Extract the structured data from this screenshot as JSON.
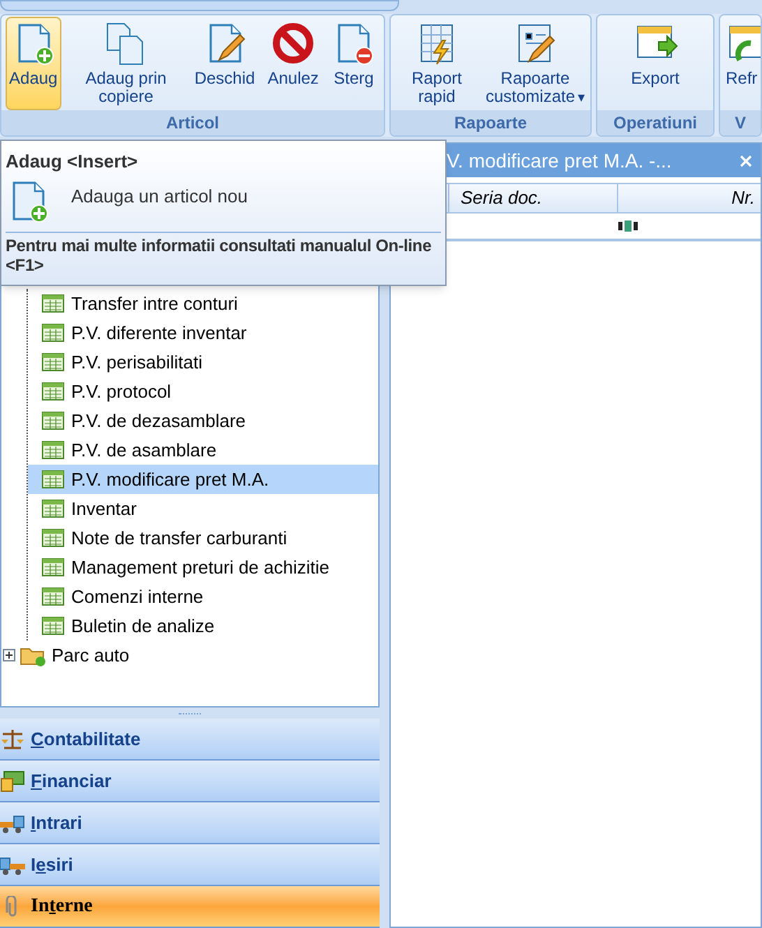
{
  "ribbon": {
    "groups": [
      {
        "label": "Articol",
        "buttons": [
          {
            "label": "Adaug",
            "highlighted": true
          },
          {
            "label": "Adaug prin copiere",
            "highlighted": false
          },
          {
            "label": "Deschid",
            "highlighted": false
          },
          {
            "label": "Anulez",
            "highlighted": false
          },
          {
            "label": "Sterg",
            "highlighted": false
          }
        ]
      },
      {
        "label": "Rapoarte",
        "buttons": [
          {
            "label": "Raport rapid",
            "highlighted": false
          },
          {
            "label": "Rapoarte customizate",
            "caret": "▾",
            "highlighted": false
          }
        ]
      },
      {
        "label": "Operatiuni",
        "buttons": [
          {
            "label": "Export",
            "highlighted": false
          }
        ]
      },
      {
        "label": "V",
        "buttons": [
          {
            "label": "Refr",
            "highlighted": false
          }
        ]
      }
    ]
  },
  "tooltip": {
    "title": "Adaug <Insert>",
    "description": "Adauga un articol nou",
    "help": "Pentru mai multe informatii consultati manualul On-line <F1>"
  },
  "tree": [
    {
      "kind": "group",
      "children": [
        {
          "label": "Transfer intre conturi",
          "selected": false
        },
        {
          "label": "P.V. diferente inventar",
          "selected": false
        },
        {
          "label": "P.V. perisabilitati",
          "selected": false
        },
        {
          "label": "P.V. protocol",
          "selected": false
        },
        {
          "label": "P.V. de dezasamblare",
          "selected": false
        },
        {
          "label": "P.V. de asamblare",
          "selected": false
        },
        {
          "label": "P.V. modificare pret M.A.",
          "selected": true
        },
        {
          "label": "Inventar",
          "selected": false
        },
        {
          "label": "Note de transfer carburanti",
          "selected": false
        },
        {
          "label": "Management preturi de achizitie",
          "selected": false
        },
        {
          "label": "Comenzi interne",
          "selected": false
        },
        {
          "label": "Buletin de analize",
          "selected": false
        }
      ]
    },
    {
      "kind": "folder",
      "label": "Parc auto",
      "expanded": false
    }
  ],
  "nav": [
    {
      "key": "C",
      "after": "ontabilitate",
      "selected": false
    },
    {
      "key": "F",
      "after": "inanciar",
      "selected": false
    },
    {
      "key": "I",
      "after": "ntrari",
      "selected": false
    },
    {
      "before": "I",
      "key": "e",
      "after": "siri",
      "selected": false
    },
    {
      "before": "In",
      "key": "t",
      "after": "erne",
      "selected": true
    }
  ],
  "document": {
    "tab_title": "V. modificare pret M.A. -...",
    "columns": [
      "Seria doc.",
      "Nr."
    ]
  }
}
